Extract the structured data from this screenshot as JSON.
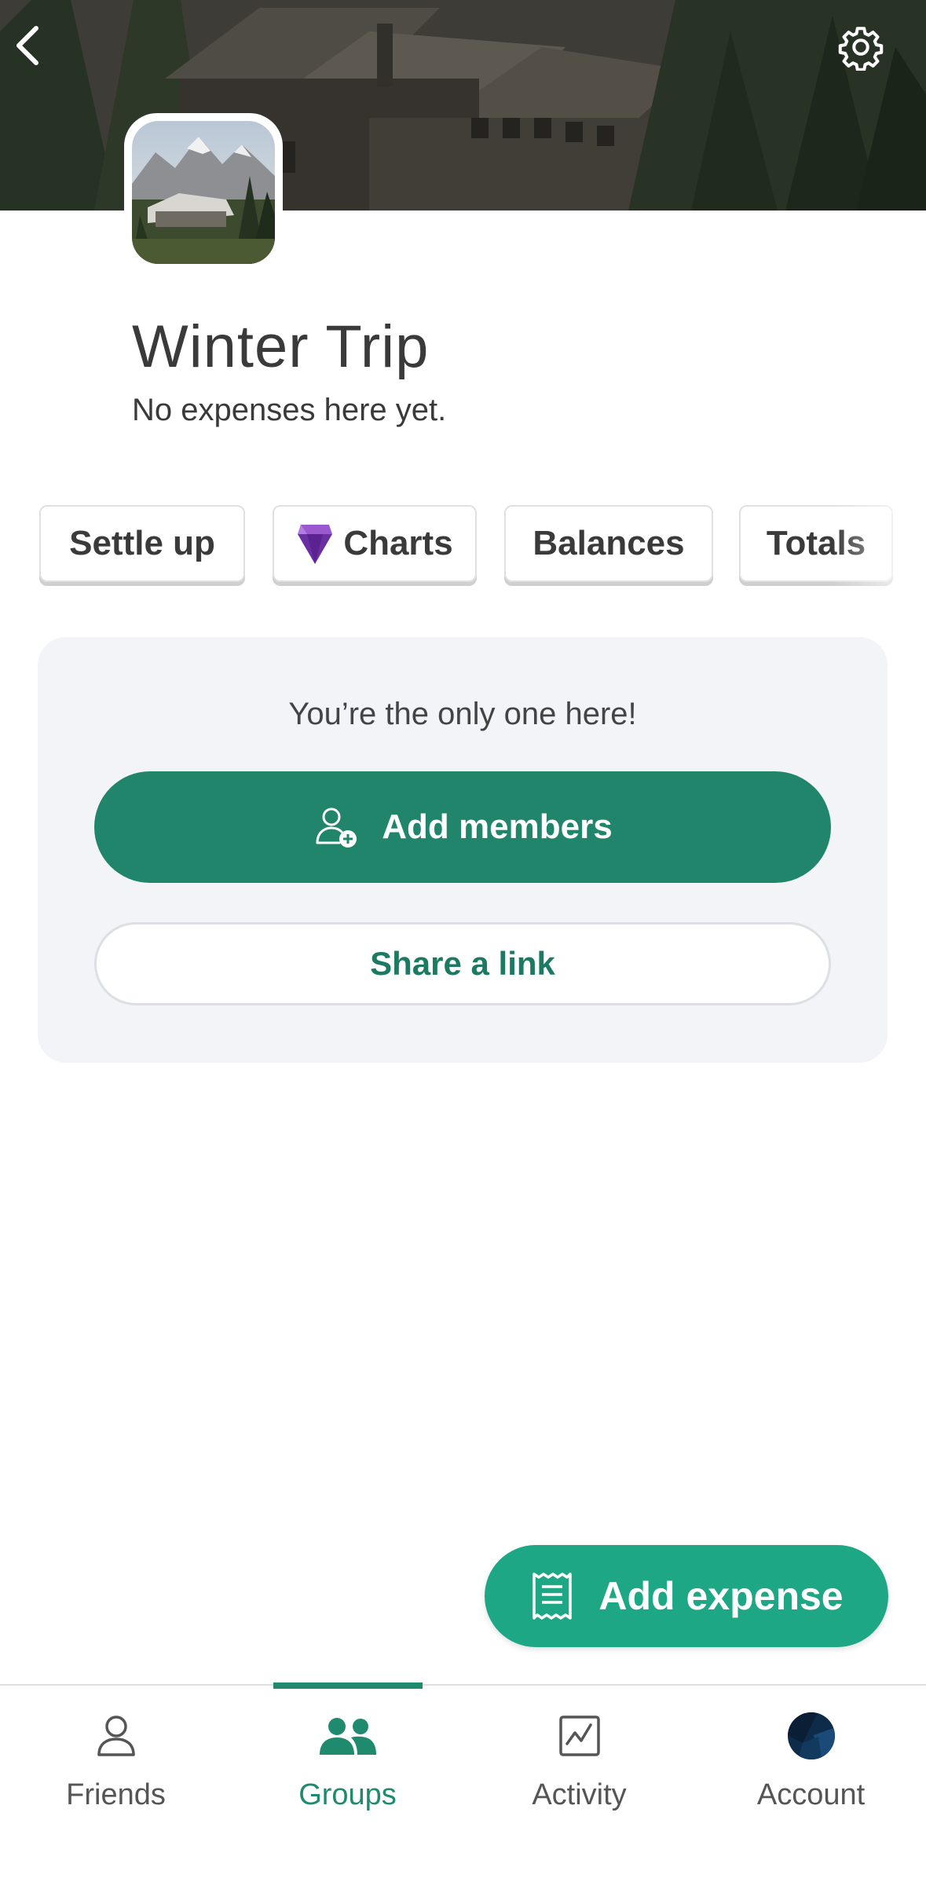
{
  "header": {
    "back_icon": "chevron-left-icon",
    "settings_icon": "gear-icon"
  },
  "group": {
    "name": "Winter Trip",
    "status": "No expenses here yet."
  },
  "chips": [
    {
      "label": "Settle up"
    },
    {
      "label": "Charts",
      "icon": "gem-icon"
    },
    {
      "label": "Balances"
    },
    {
      "label": "Totals"
    }
  ],
  "empty_card": {
    "message": "You’re the only one here!",
    "add_members_label": "Add members",
    "share_link_label": "Share a link"
  },
  "fab": {
    "label": "Add expense",
    "icon": "receipt-icon"
  },
  "tabs": [
    {
      "label": "Friends",
      "icon": "person-icon"
    },
    {
      "label": "Groups",
      "icon": "people-icon",
      "active": true
    },
    {
      "label": "Activity",
      "icon": "activity-chart-icon"
    },
    {
      "label": "Account",
      "icon": "avatar"
    }
  ],
  "colors": {
    "primary": "#20856a",
    "fab": "#1ea784",
    "active_tab": "#1f8a6e",
    "gem": "#6a2fa0"
  }
}
